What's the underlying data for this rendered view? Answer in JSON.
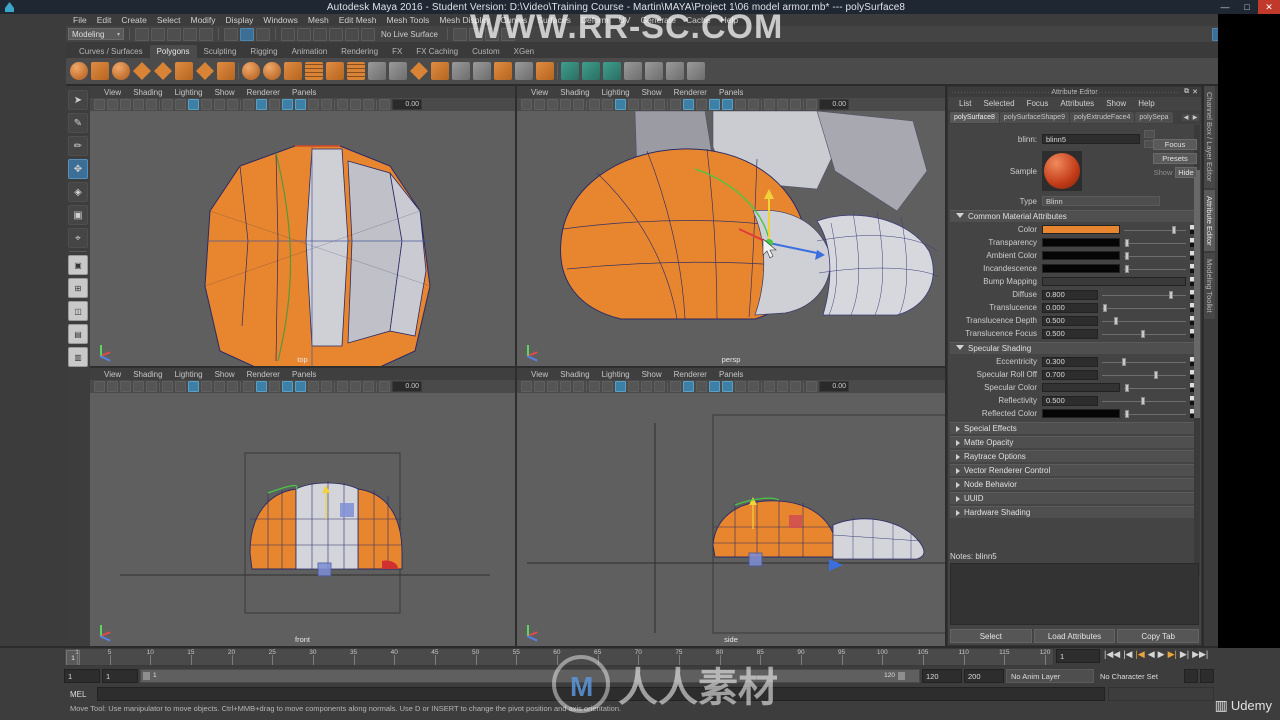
{
  "titlebar": {
    "title": "Autodesk Maya 2016 - Student Version: D:\\Video\\Training Course - Martin\\MAYA\\Project 1\\06 model armor.mb*   ---   polySurface8",
    "minimize": "—",
    "maximize": "□",
    "close": "✕"
  },
  "menubar": {
    "items": [
      "File",
      "Edit",
      "Create",
      "Select",
      "Modify",
      "Display",
      "Windows",
      "Mesh",
      "Edit Mesh",
      "Mesh Tools",
      "Mesh Display",
      "Curves",
      "Surfaces",
      "Deform",
      "UV",
      "Generate",
      "Cache",
      "Help"
    ]
  },
  "statusline": {
    "mode": "Modeling",
    "live_surface": "No Live Surface"
  },
  "shelf": {
    "tabs": [
      "Curves / Surfaces",
      "Polygons",
      "Sculpting",
      "Rigging",
      "Animation",
      "Rendering",
      "FX",
      "FX Caching",
      "Custom",
      "XGen"
    ],
    "active_tab": "Polygons"
  },
  "viewports": [
    {
      "name": "top",
      "label": "top",
      "menu": [
        "View",
        "Shading",
        "Lighting",
        "Show",
        "Renderer",
        "Panels"
      ],
      "zoom_value": "0.00"
    },
    {
      "name": "persp",
      "label": "persp",
      "menu": [
        "View",
        "Shading",
        "Lighting",
        "Show",
        "Renderer",
        "Panels"
      ],
      "zoom_value": "0.00"
    },
    {
      "name": "front",
      "label": "front",
      "menu": [
        "View",
        "Shading",
        "Lighting",
        "Show",
        "Renderer",
        "Panels"
      ],
      "zoom_value": "0.00"
    },
    {
      "name": "side",
      "label": "side",
      "menu": [
        "View",
        "Shading",
        "Lighting",
        "Show",
        "Renderer",
        "Panels"
      ],
      "zoom_value": "0.00"
    }
  ],
  "attribute_editor": {
    "panel_title": "Attribute Editor",
    "menu": [
      "List",
      "Selected",
      "Focus",
      "Attributes",
      "Show",
      "Help"
    ],
    "tabs": [
      "polySurface8",
      "polySurfaceShape9",
      "polyExtrudeFace4",
      "polySepa"
    ],
    "active_tab": "polySurface8",
    "node_label": "blinn:",
    "node_name": "blinn5",
    "sample_label": "Sample",
    "type_label": "Type",
    "type_value": "Blinn",
    "buttons": {
      "focus": "Focus",
      "presets": "Presets",
      "show": "Show",
      "hide": "Hide"
    },
    "sections": [
      {
        "title": "Common Material Attributes",
        "expanded": true,
        "attributes": [
          {
            "label": "Color",
            "kind": "color",
            "color": "#e8862f",
            "slider": 0.78
          },
          {
            "label": "Transparency",
            "kind": "color",
            "color": "#050505",
            "slider": 0.02
          },
          {
            "label": "Ambient Color",
            "kind": "color",
            "color": "#050505",
            "slider": 0.02
          },
          {
            "label": "Incandescence",
            "kind": "color",
            "color": "#050505",
            "slider": 0.02
          },
          {
            "label": "Bump Mapping",
            "kind": "bump",
            "color": "#3a3a3a",
            "slider": null
          },
          {
            "label": "Diffuse",
            "kind": "value",
            "value": "0.800",
            "slider": 0.8
          },
          {
            "label": "Translucence",
            "kind": "value",
            "value": "0.000",
            "slider": 0.02
          },
          {
            "label": "Translucence Depth",
            "kind": "value",
            "value": "0.500",
            "slider": 0.14
          },
          {
            "label": "Translucence Focus",
            "kind": "value",
            "value": "0.500",
            "slider": 0.46
          }
        ]
      },
      {
        "title": "Specular Shading",
        "expanded": true,
        "attributes": [
          {
            "label": "Eccentricity",
            "kind": "value",
            "value": "0.300",
            "slider": 0.24
          },
          {
            "label": "Specular Roll Off",
            "kind": "value",
            "value": "0.700",
            "slider": 0.62
          },
          {
            "label": "Specular Color",
            "kind": "color",
            "color": "#323232",
            "slider": 0.02
          },
          {
            "label": "Reflectivity",
            "kind": "value",
            "value": "0.500",
            "slider": 0.46
          },
          {
            "label": "Reflected Color",
            "kind": "color",
            "color": "#050505",
            "slider": 0.02
          }
        ]
      }
    ],
    "collapsed_sections": [
      "Special Effects",
      "Matte Opacity",
      "Raytrace Options",
      "Vector Renderer Control",
      "Node Behavior",
      "UUID",
      "Hardware Shading"
    ],
    "notes_label": "Notes:",
    "notes_value": "blinn5",
    "footer_buttons": [
      "Select",
      "Load Attributes",
      "Copy Tab"
    ]
  },
  "right_tabs": {
    "items": [
      "Channel Box / Layer Editor",
      "Attribute Editor",
      "Modeling Toolkit"
    ],
    "active": "Attribute Editor"
  },
  "timeline": {
    "ruler_ticks": [
      1,
      5,
      10,
      15,
      20,
      25,
      30,
      35,
      40,
      45,
      50,
      55,
      60,
      65,
      70,
      75,
      80,
      85,
      90,
      95,
      100,
      105,
      110,
      115,
      120
    ],
    "current_frame_marker": "1",
    "current_frame_field": "1",
    "playback_buttons": [
      "|◀◀",
      "|◀",
      "|◀",
      "◀",
      "▶",
      "▶|",
      "▶|",
      "▶▶|"
    ],
    "range_start": "1",
    "range_start2": "1",
    "range_bar_start": "1",
    "range_bar_end": "120",
    "range_end": "120",
    "playback_end": "200",
    "anim_layer": "No Anim Layer",
    "character_set": "No Character Set"
  },
  "command_line": {
    "language": "MEL",
    "input_value": "",
    "help_text": "Move Tool: Use manipulator to move objects. Ctrl+MMB+drag to move components along normals. Use D or INSERT to change the pivot position and axis orientation."
  },
  "watermarks": {
    "url": "WWW.RR-SC.COM",
    "chinese": "人人素材",
    "udemy": "Udemy"
  },
  "colors": {
    "accent_orange": "#e8862f",
    "ui_bg": "#444444",
    "viewport_bg": "#5f5f5f",
    "selection_blue": "#3d6f96"
  }
}
